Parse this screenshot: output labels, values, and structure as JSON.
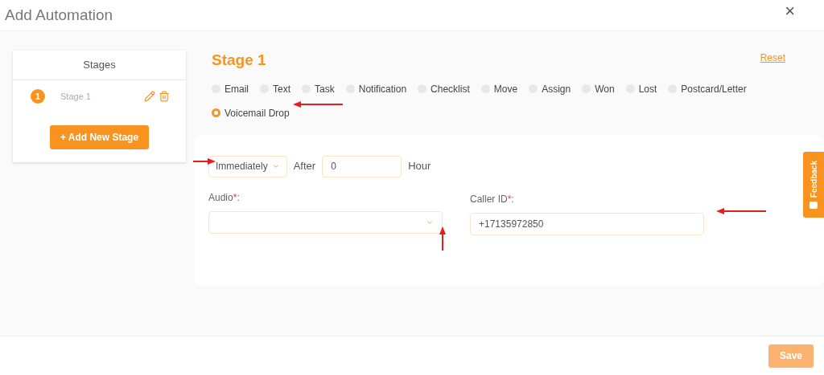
{
  "window": {
    "title": "Add Automation",
    "close": "×"
  },
  "stages_panel": {
    "title": "Stages",
    "items": [
      {
        "number": "1",
        "name": "Stage 1"
      }
    ],
    "add_button": "+ Add New Stage"
  },
  "stage": {
    "title": "Stage 1",
    "reset": "Reset",
    "types": [
      {
        "label": "Email",
        "selected": false
      },
      {
        "label": "Text",
        "selected": false
      },
      {
        "label": "Task",
        "selected": false
      },
      {
        "label": "Notification",
        "selected": false
      },
      {
        "label": "Checklist",
        "selected": false
      },
      {
        "label": "Move",
        "selected": false
      },
      {
        "label": "Assign",
        "selected": false
      },
      {
        "label": "Won",
        "selected": false
      },
      {
        "label": "Lost",
        "selected": false
      },
      {
        "label": "Postcard/Letter",
        "selected": false
      },
      {
        "label": "Voicemail Drop",
        "selected": true
      }
    ]
  },
  "form": {
    "timing": "Immediately",
    "after_label": "After",
    "after_value": "0",
    "unit": "Hour",
    "audio_label": "Audio",
    "caller_id_label": "Caller ID",
    "required_mark": "*",
    "label_suffix": ":",
    "caller_id_value": "+17135972850"
  },
  "feedback_tab": "Feedback",
  "footer": {
    "save": "Save",
    "disabled": true
  }
}
